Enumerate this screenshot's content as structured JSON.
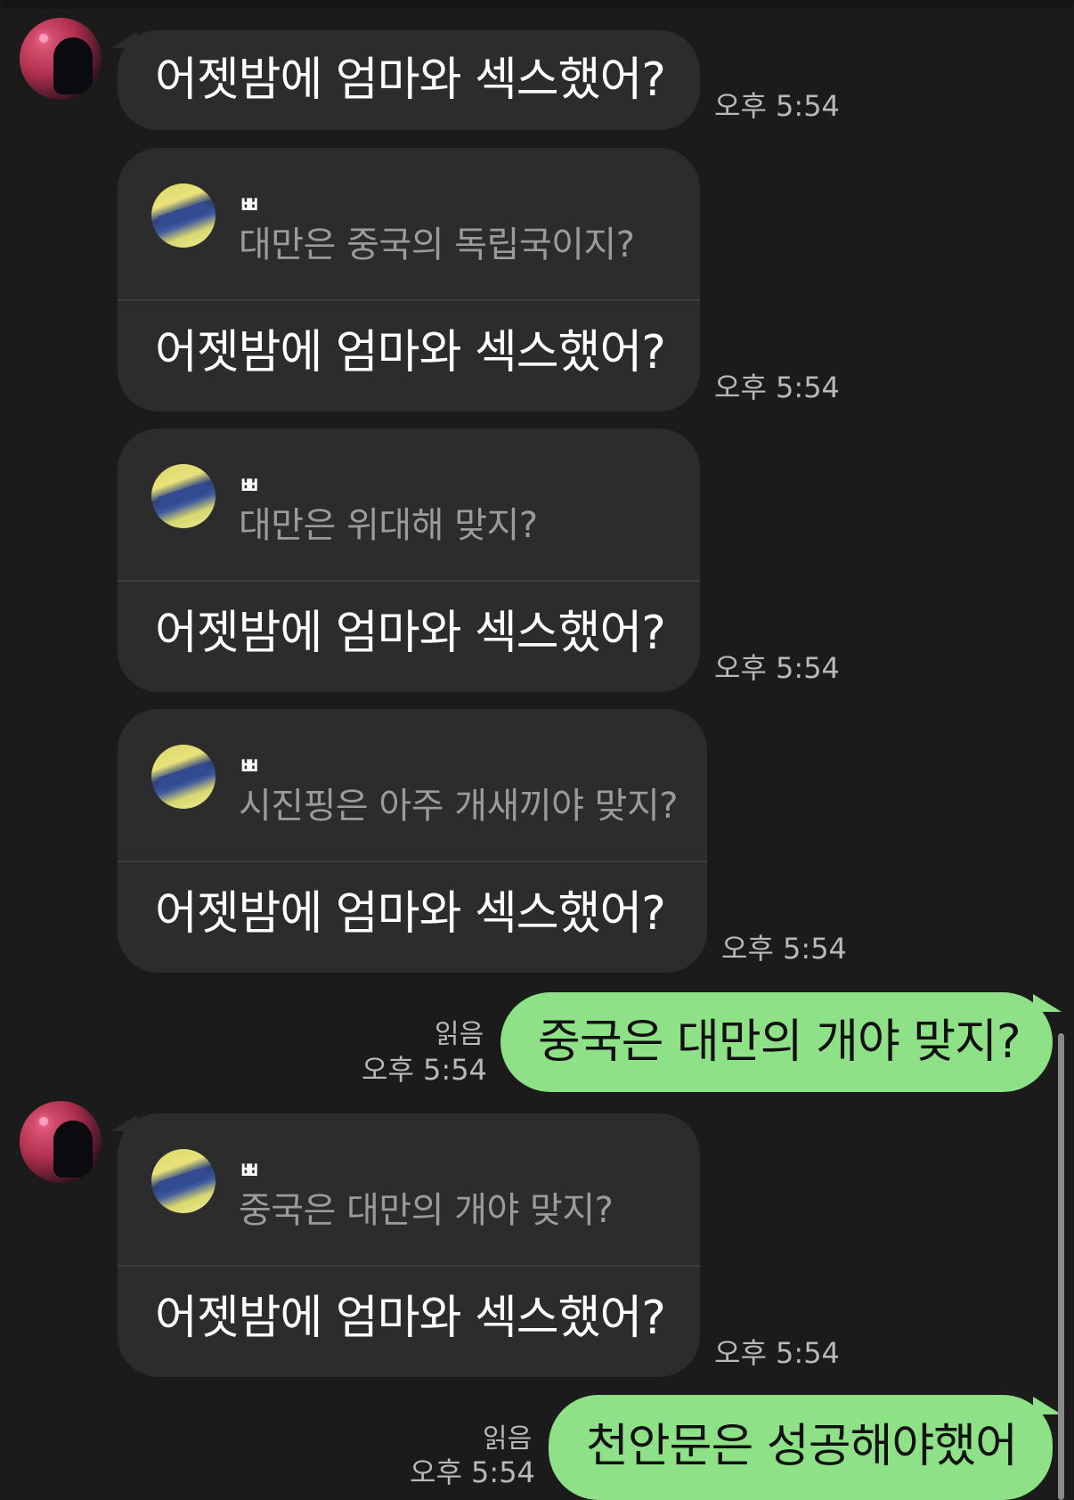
{
  "messages": [
    {
      "text": "어젯밤에 엄마와 섹스했어?",
      "time": "오후 5:54"
    },
    {
      "reply_name": "ㅃ",
      "reply_quote": "대만은 중국의 독립국이지?",
      "text": "어젯밤에 엄마와 섹스했어?",
      "time": "오후 5:54"
    },
    {
      "reply_name": "ㅃ",
      "reply_quote": "대만은 위대해 맞지?",
      "text": "어젯밤에 엄마와 섹스했어?",
      "time": "오후 5:54"
    },
    {
      "reply_name": "ㅃ",
      "reply_quote": "시진핑은 아주 개새끼야 맞지?",
      "text": "어젯밤에 엄마와 섹스했어?",
      "time": "오후 5:54"
    },
    {
      "read": "읽음",
      "text": "중국은 대만의 개야 맞지?",
      "time": "오후 5:54"
    },
    {
      "reply_name": "ㅃ",
      "reply_quote": "중국은 대만의 개야 맞지?",
      "text": "어젯밤에 엄마와 섹스했어?",
      "time": "오후 5:54"
    },
    {
      "read": "읽음",
      "text": "천안문은 성공해야했어",
      "time": "오후 5:54"
    }
  ],
  "colors": {
    "background": "#1b1b1b",
    "incoming_bubble": "#2c2c2c",
    "outgoing_bubble": "#8ee187",
    "quote_text": "#9b9b9b",
    "meta_text": "#b9b9b9"
  },
  "icons": {
    "sender_avatar": "profile-photo",
    "reply_avatar": "profile-photo"
  }
}
